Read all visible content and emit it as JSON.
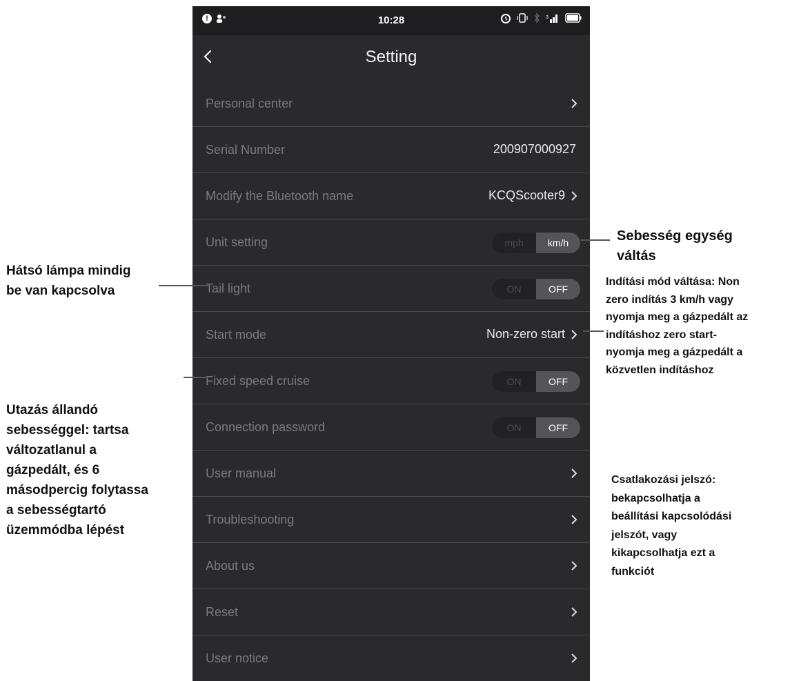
{
  "status_bar": {
    "time": "10:28"
  },
  "header": {
    "title": "Setting"
  },
  "rows": [
    {
      "label": "Personal center"
    },
    {
      "label": "Serial Number",
      "value": "200907000927"
    },
    {
      "label": "Modify the Bluetooth name",
      "value": "KCQScooter9"
    },
    {
      "label": "Unit setting",
      "options": [
        "mph",
        "km/h"
      ],
      "selected": "km/h"
    },
    {
      "label": "Tail light",
      "options": [
        "ON",
        "OFF"
      ],
      "selected": "OFF"
    },
    {
      "label": "Start mode",
      "value": "Non-zero start"
    },
    {
      "label": "Fixed speed cruise",
      "options": [
        "ON",
        "OFF"
      ],
      "selected": "OFF"
    },
    {
      "label": "Connection password",
      "options": [
        "ON",
        "OFF"
      ],
      "selected": "OFF"
    },
    {
      "label": "User manual"
    },
    {
      "label": "Troubleshooting"
    },
    {
      "label": "About us"
    },
    {
      "label": "Reset"
    },
    {
      "label": "User notice"
    }
  ],
  "annotations": {
    "tail_light": "Hátsó lámpa mindig\nbe van kapcsolva",
    "cruise": "Utazás állandó\nsebességgel: tartsa\nváltozatlanul a\ngázpedált, és 6\nmásodpercig folytassa\na sebességtartó\nüzemmódba lépést",
    "unit": "Sebesség egység\nváltás",
    "start_mode": "Indítási mód váltása: Non\nzero indítás 3 km/h vagy\nnyomja meg a gázpedált az\nindításhoz zero start-\nnyomja meg a gázpedált a\nközvetlen indításhoz",
    "password": "Csatlakozási jelszó:\nbekapcsolhatja a\nbeállítási kapcsolódási\njelszót, vagy\nkikapcsolhatja ezt a\nfunkciót"
  },
  "icons": {
    "back": "chevron-left-icon",
    "chevron": "chevron-right-icon",
    "status": [
      "info-icon",
      "person-icon",
      "alarm-icon",
      "vibrate-icon",
      "bluetooth-icon",
      "signal-icon",
      "battery-icon"
    ]
  },
  "colors": {
    "background": "#2a2a2c",
    "label": "#7a7a7c",
    "value": "#eaeaea",
    "toggle_active": "#555557"
  }
}
